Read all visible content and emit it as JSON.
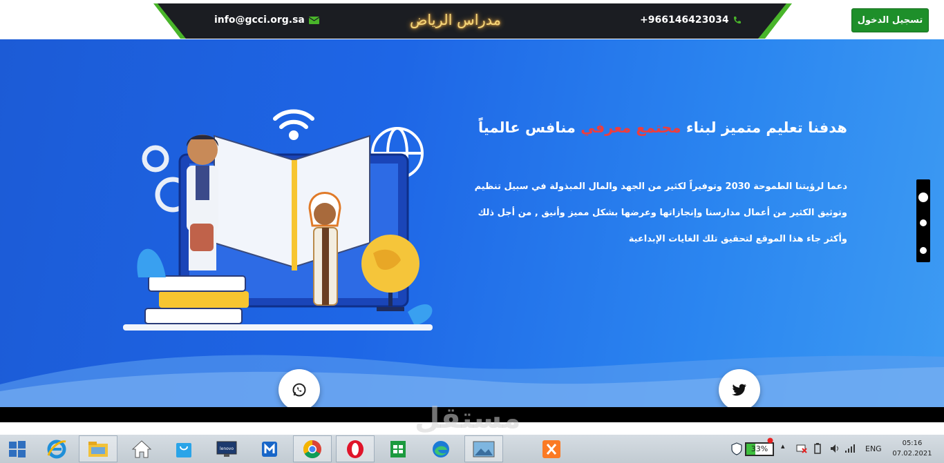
{
  "header": {
    "email": "info@gcci.org.sa",
    "brand": "مدراس الرياض",
    "phone": "+966146423034",
    "login_label": "تسجيل الدخول"
  },
  "hero": {
    "headline_part1": "هدفنا تعليم متميز لبناء",
    "headline_highlight": "مجتمع معرفي",
    "headline_part2": "منافس عالمياً",
    "paragraph": [
      "دعما لرؤيتنا الطموحة 2030 وتوفيراً لكثير من الجهد والمال المبذولة في سبيل تنظيم",
      "وتوثيق الكثير من أعمال مدارسنا وإنجازاتها وعرضها بشكل مميز وأنيق , من أجل ذلك",
      "وأكثر جاء هذا الموقع لتحقيق تلك الغايات الإبداعية"
    ],
    "slider_dots": 3,
    "active_dot": 1
  },
  "watermark": "مستقل",
  "taskbar": {
    "battery_label": "33%",
    "battery_level": 0.33,
    "language": "ENG",
    "time": "05:16",
    "date": "07.02.2021",
    "apps": [
      "start-icon",
      "internet-explorer-icon",
      "file-explorer-icon",
      "home-icon",
      "store-bag-icon",
      "lenovo-icon",
      "maxthon-icon",
      "chrome-icon",
      "opera-icon",
      "office-icon",
      "edge-icon",
      "photos-icon",
      "xampp-icon"
    ]
  },
  "colors": {
    "accent_green": "#49b52a",
    "login_green": "#1e8f2a",
    "hero_blue": "#1e66e6",
    "highlight_red": "#ee3d3d",
    "brand_gold": "#f5d77a"
  }
}
